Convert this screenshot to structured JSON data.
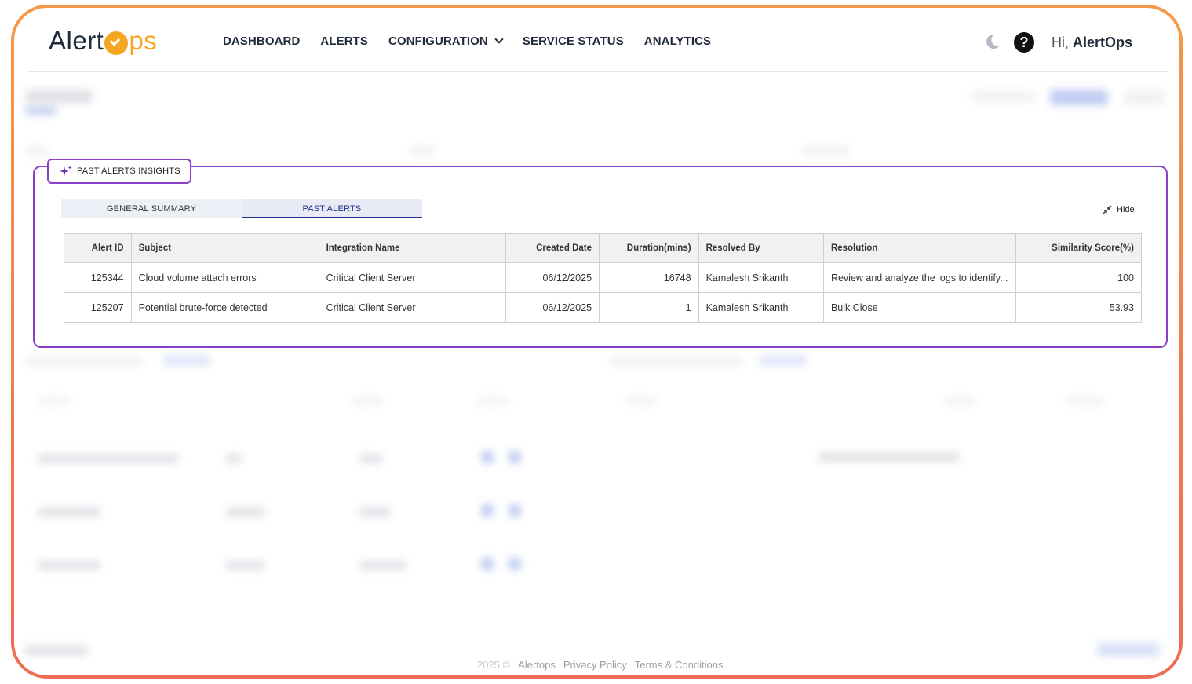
{
  "header": {
    "logo": {
      "part1": "Alert",
      "part2": "ps",
      "icon": "clock-check-icon",
      "brand_color": "#f5a623"
    },
    "nav": [
      {
        "label": "DASHBOARD"
      },
      {
        "label": "ALERTS"
      },
      {
        "label": "CONFIGURATION",
        "has_dropdown": true
      },
      {
        "label": "SERVICE STATUS"
      },
      {
        "label": "ANALYTICS"
      }
    ],
    "theme_icon": "moon-icon",
    "help_icon": "question-circle-icon",
    "greeting_prefix": "Hi,",
    "user_name": "AlertOps"
  },
  "insights": {
    "badge_label": "PAST ALERTS INSIGHTS",
    "badge_icon": "sparkle-icon",
    "accent_color": "#8a3fc9",
    "tabs": [
      {
        "label": "GENERAL SUMMARY",
        "active": false
      },
      {
        "label": "PAST ALERTS",
        "active": true
      }
    ],
    "hide_label": "Hide",
    "hide_icon": "collapse-icon",
    "table": {
      "columns": [
        "Alert ID",
        "Subject",
        "Integration Name",
        "Created Date",
        "Duration(mins)",
        "Resolved By",
        "Resolution",
        "Similarity Score(%)"
      ],
      "rows": [
        [
          "125344",
          "Cloud volume attach errors",
          "Critical Client Server",
          "06/12/2025",
          "16748",
          "Kamalesh Srikanth",
          "Review and analyze the logs to identify...",
          "100"
        ],
        [
          "125207",
          "Potential brute-force detected",
          "Critical Client Server",
          "06/12/2025",
          "1",
          "Kamalesh Srikanth",
          "Bulk Close",
          "53.93"
        ]
      ]
    }
  },
  "footer": {
    "year": "2025 ©",
    "brand": "Alertops",
    "privacy": "Privacy Policy",
    "terms": "Terms & Conditions"
  }
}
